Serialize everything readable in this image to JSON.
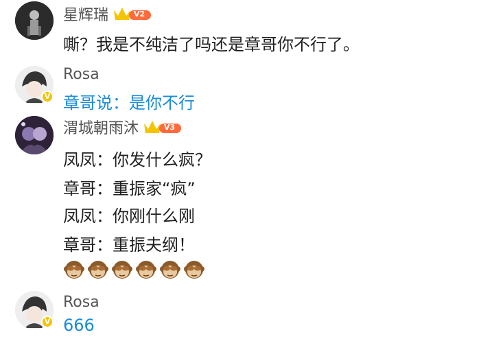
{
  "comments": [
    {
      "username": "星辉瑞",
      "level": "V2",
      "lines": [
        "嘶？我是不纯洁了吗还是章哥你不行了。"
      ]
    },
    {
      "username": "Rosa",
      "verified": "V",
      "lines": [
        "章哥说：是你不行"
      ]
    },
    {
      "username": "渭城朝雨沐",
      "level": "V3",
      "lines": [
        "凤凤：你发什么疯？",
        "章哥：重振家“疯”",
        "凤凤：你刚什么刚",
        "章哥：重振夫纲！"
      ],
      "emoji_count": 6,
      "emoji_name": "see-no-evil-monkey-icon"
    },
    {
      "username": "Rosa",
      "verified": "V",
      "lines": [
        "666"
      ]
    }
  ],
  "colors": {
    "reply_text": "#1a8bd8",
    "username": "#555555",
    "vip_badge": "#f5c400",
    "level_badge": "#ff6b3d"
  }
}
